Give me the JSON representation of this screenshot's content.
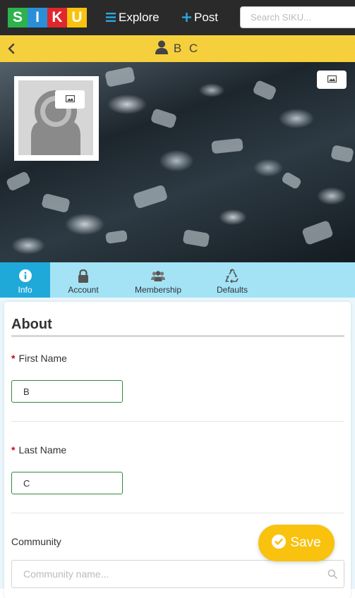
{
  "app": {
    "logo_letters": [
      "S",
      "I",
      "K",
      "U"
    ],
    "logo_colors": [
      "#2eb24b",
      "#2a8fd6",
      "#e0272e",
      "#f8c20f"
    ]
  },
  "nav": {
    "explore_label": "Explore",
    "explore_icon": "hamburger-menu-icon",
    "post_label": "Post",
    "post_icon": "plus-icon",
    "search_placeholder": "Search SIKU..."
  },
  "header": {
    "back_icon": "chevron-left-icon",
    "user_icon": "user-icon",
    "title": "B C"
  },
  "cover": {
    "edit_icon": "image-icon",
    "avatar_edit_icon": "image-icon",
    "avatar_placeholder_icon": "user-silhouette-icon"
  },
  "tabs": [
    {
      "label": "Info",
      "icon": "info-icon",
      "active": true
    },
    {
      "label": "Account",
      "icon": "lock-icon",
      "active": false
    },
    {
      "label": "Membership",
      "icon": "group-icon",
      "active": false
    },
    {
      "label": "Defaults",
      "icon": "recycle-icon",
      "active": false
    }
  ],
  "form": {
    "section_title": "About",
    "required_marker": "*",
    "first_name_label": "First Name",
    "first_name_value": "B",
    "last_name_label": "Last Name",
    "last_name_value": "C",
    "community_label": "Community",
    "community_placeholder": "Community name...",
    "community_search_icon": "search-icon"
  },
  "save_button": {
    "label": "Save",
    "icon": "check-circle-icon"
  },
  "colors": {
    "topbar": "#2a2a2a",
    "titlebar": "#f6cf3c",
    "tabs_bg": "#a3e3f5",
    "tab_active": "#1fa9d9",
    "nav_icon": "#2aa9e0",
    "input_border": "#2e8b3e",
    "required": "#d0021b",
    "save_bg": "#f8c20f"
  }
}
